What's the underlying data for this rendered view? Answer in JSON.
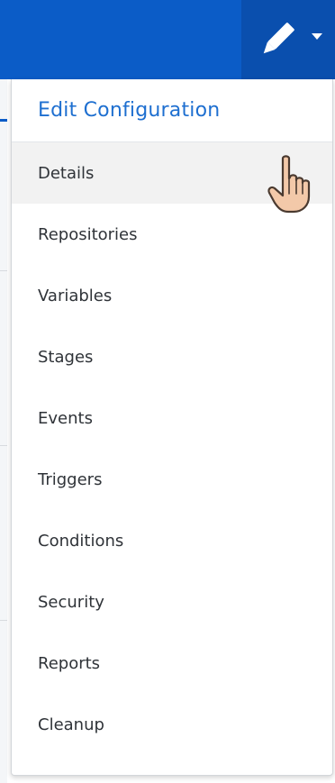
{
  "toolbar": {
    "edit_icon": "pencil-icon",
    "dropdown_icon": "caret-down-icon",
    "colors": {
      "bar": "#0b5cc7",
      "button": "#0a4fae"
    }
  },
  "dropdown": {
    "title": "Edit Configuration",
    "title_color": "#1e6fd0",
    "items": [
      {
        "label": "Details",
        "active": true
      },
      {
        "label": "Repositories"
      },
      {
        "label": "Variables"
      },
      {
        "label": "Stages"
      },
      {
        "label": "Events"
      },
      {
        "label": "Triggers"
      },
      {
        "label": "Conditions"
      },
      {
        "label": "Security"
      },
      {
        "label": "Reports"
      },
      {
        "label": "Cleanup"
      }
    ]
  },
  "cursor": {
    "icon": "hand-pointer-icon"
  }
}
